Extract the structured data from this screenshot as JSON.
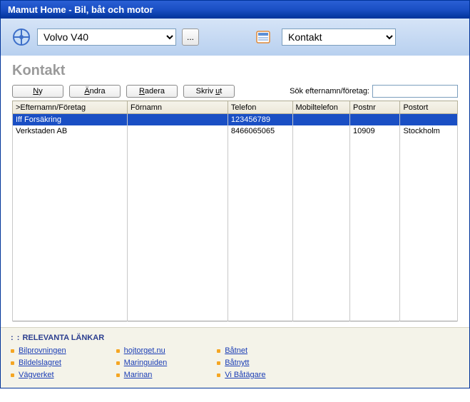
{
  "window": {
    "title": "Mamut Home - Bil, båt och motor"
  },
  "toolbar": {
    "dropdown1": "Volvo V40",
    "dropdown2": "Kontakt",
    "more_btn": "..."
  },
  "page": {
    "title": "Kontakt"
  },
  "buttons": {
    "ny": "Ny",
    "andra": "Ändra",
    "radera": "Radera",
    "skrivut": "Skriv ut"
  },
  "search": {
    "label": "Sök efternamn/företag:",
    "value": ""
  },
  "grid": {
    "headers": [
      ">Efternamn/Företag",
      "Förnamn",
      "Telefon",
      "Mobiltelefon",
      "Postnr",
      "Postort"
    ],
    "rows": [
      {
        "selected": true,
        "cells": [
          "Iff Forsäkring",
          "",
          "123456789",
          "",
          "",
          ""
        ]
      },
      {
        "selected": false,
        "cells": [
          "Verkstaden AB",
          "",
          "8466065065",
          "",
          "10909",
          "Stockholm"
        ]
      }
    ]
  },
  "links": {
    "title": "RELEVANTA LÄNKAR",
    "cols": [
      [
        "Bilprovningen",
        "Bildelslagret",
        "Vägverket"
      ],
      [
        "hojtorget.nu",
        "Maringuiden",
        "Marinan"
      ],
      [
        "Båtnet",
        "Båtnytt",
        "Vi Båtägare"
      ]
    ]
  }
}
